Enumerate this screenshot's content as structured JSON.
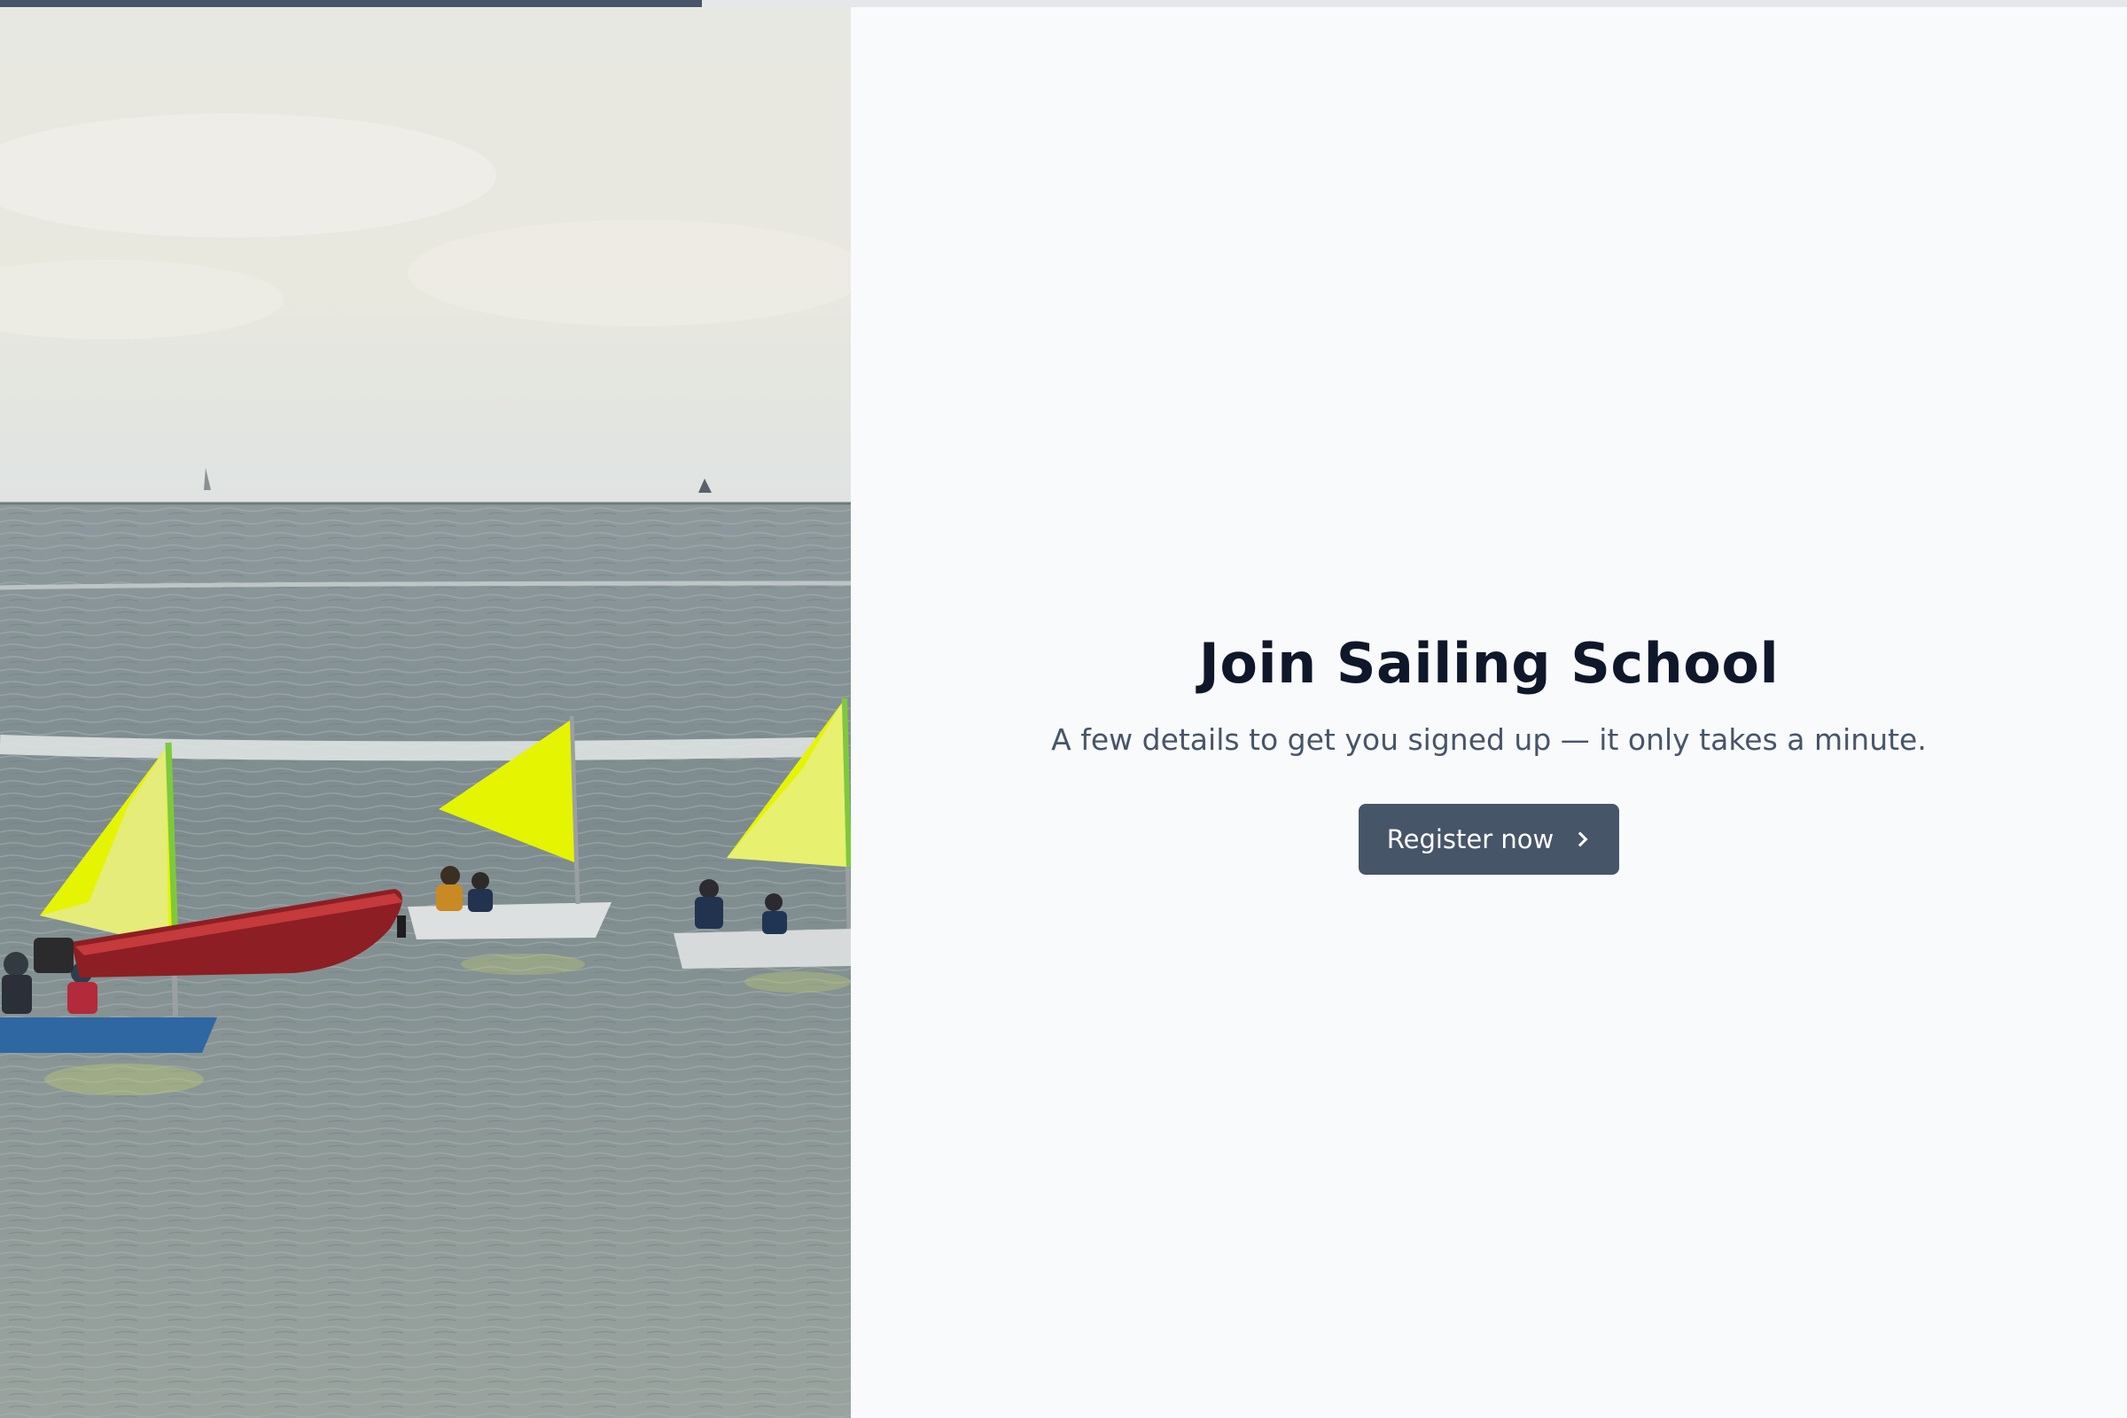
{
  "progress": {
    "value": 0.33
  },
  "hero": {
    "image": "sailing-dinghies-photo"
  },
  "main": {
    "title": "Join Sailing School",
    "subtitle": "A few details to get you signed up — it only takes a minute.",
    "cta_label": "Register now",
    "cta_icon": "chevron-right-icon"
  },
  "colors": {
    "accent": "#475569",
    "title": "#0f172a",
    "subtitle": "#475569",
    "panel_bg": "#f8fafc",
    "sail": "#e5f400"
  }
}
